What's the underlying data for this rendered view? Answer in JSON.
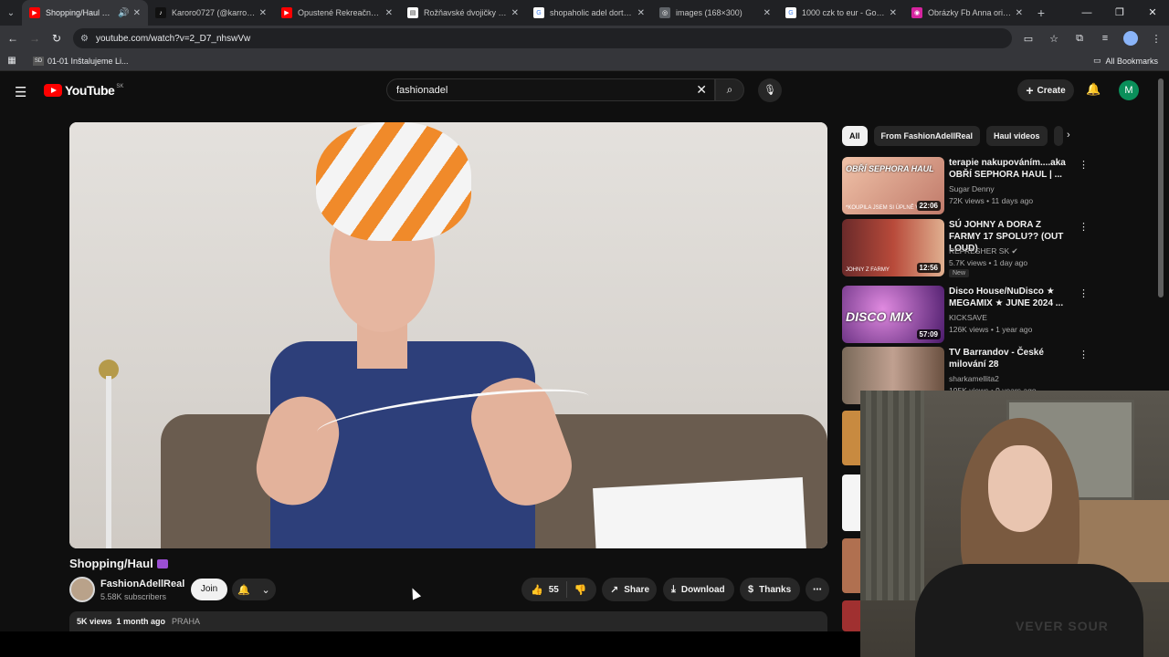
{
  "browser": {
    "tabs": [
      {
        "title": "Shopping/Haul 🛍️ - Yo",
        "active": true,
        "favicon": "youtube-icon",
        "color": "#ff0000"
      },
      {
        "title": "Karoro0727 (@karroro07",
        "active": false,
        "favicon": "tiktok-icon",
        "color": "#111111"
      },
      {
        "title": "Opustené Rekreačné Zari",
        "active": false,
        "favicon": "youtube-icon",
        "color": "#ff0000"
      },
      {
        "title": "Rožňavské dvojičky v Koši",
        "active": false,
        "favicon": "page-icon",
        "color": "#ffffff"
      },
      {
        "title": "shopaholic adel dorty - G",
        "active": false,
        "favicon": "google-icon",
        "color": "#4285f4"
      },
      {
        "title": "images (168×300)",
        "active": false,
        "favicon": "globe-icon",
        "color": "#9aa0a6"
      },
      {
        "title": "1000 czk to eur - Google",
        "active": false,
        "favicon": "google-icon",
        "color": "#4285f4"
      },
      {
        "title": "Obrázky Fb Anna originál",
        "active": false,
        "favicon": "instagram-icon",
        "color": "#d6249f"
      }
    ],
    "url": "youtube.com/watch?v=2_D7_nhswVw",
    "bookmark": "01-01 Inštalujeme Li...",
    "all_bookmarks": "All Bookmarks"
  },
  "youtube": {
    "logo": "YouTube",
    "country": "SK",
    "search_value": "fashionadel",
    "create_label": "Create",
    "avatar_letter": "M"
  },
  "video": {
    "title": "Shopping/Haul",
    "channel": "FashionAdellReal",
    "subscribers": "5.58K subscribers",
    "join_label": "Join",
    "likes": "55",
    "share_label": "Share",
    "download_label": "Download",
    "thanks_label": "Thanks",
    "views": "5K views",
    "uploaded": "1 month ago",
    "location": "PRAHA"
  },
  "chips": [
    "All",
    "From FashionAdellReal",
    "Haul videos"
  ],
  "recommendations": [
    {
      "title": "terapie nakupováním....aka OBŘÍ SEPHORA HAUL | ...",
      "channel": "Sugar Denny",
      "meta": "72K views • 11 days ago",
      "duration": "22:06",
      "thumb_text": "OBŘÍ SEPHORA HAUL",
      "thumb_sub": "*KOUPILA JSEM SI ÚPLNĚ VŠ...",
      "thumb_color": "#d9a58a"
    },
    {
      "title": "SÚ JOHNY A DORA Z FARMY 17 SPOLU?? (OUT LOUD)",
      "channel": "REFRESHER SK",
      "meta": "5.7K views • 1 day ago",
      "duration": "12:56",
      "badge": "New",
      "thumb_sub": "JOHNY Z FARMY",
      "thumb_color": "#8a3a3a"
    },
    {
      "title": "Disco House/NuDisco ★ MEGAMIX ★ JUNE 2024 ...",
      "channel": "KICKSAVE",
      "meta": "126K views • 1 year ago",
      "duration": "57:09",
      "thumb_text": "DISCO MIX",
      "thumb_color": "#7a2a9a"
    },
    {
      "title": "TV Barrandov - České milování 28",
      "channel": "sharkamellita2",
      "meta": "195K views • 9 years ago",
      "thumb_color": "#a88a70"
    }
  ],
  "webcam": {
    "shirt_text": "VEVER SOUR"
  }
}
